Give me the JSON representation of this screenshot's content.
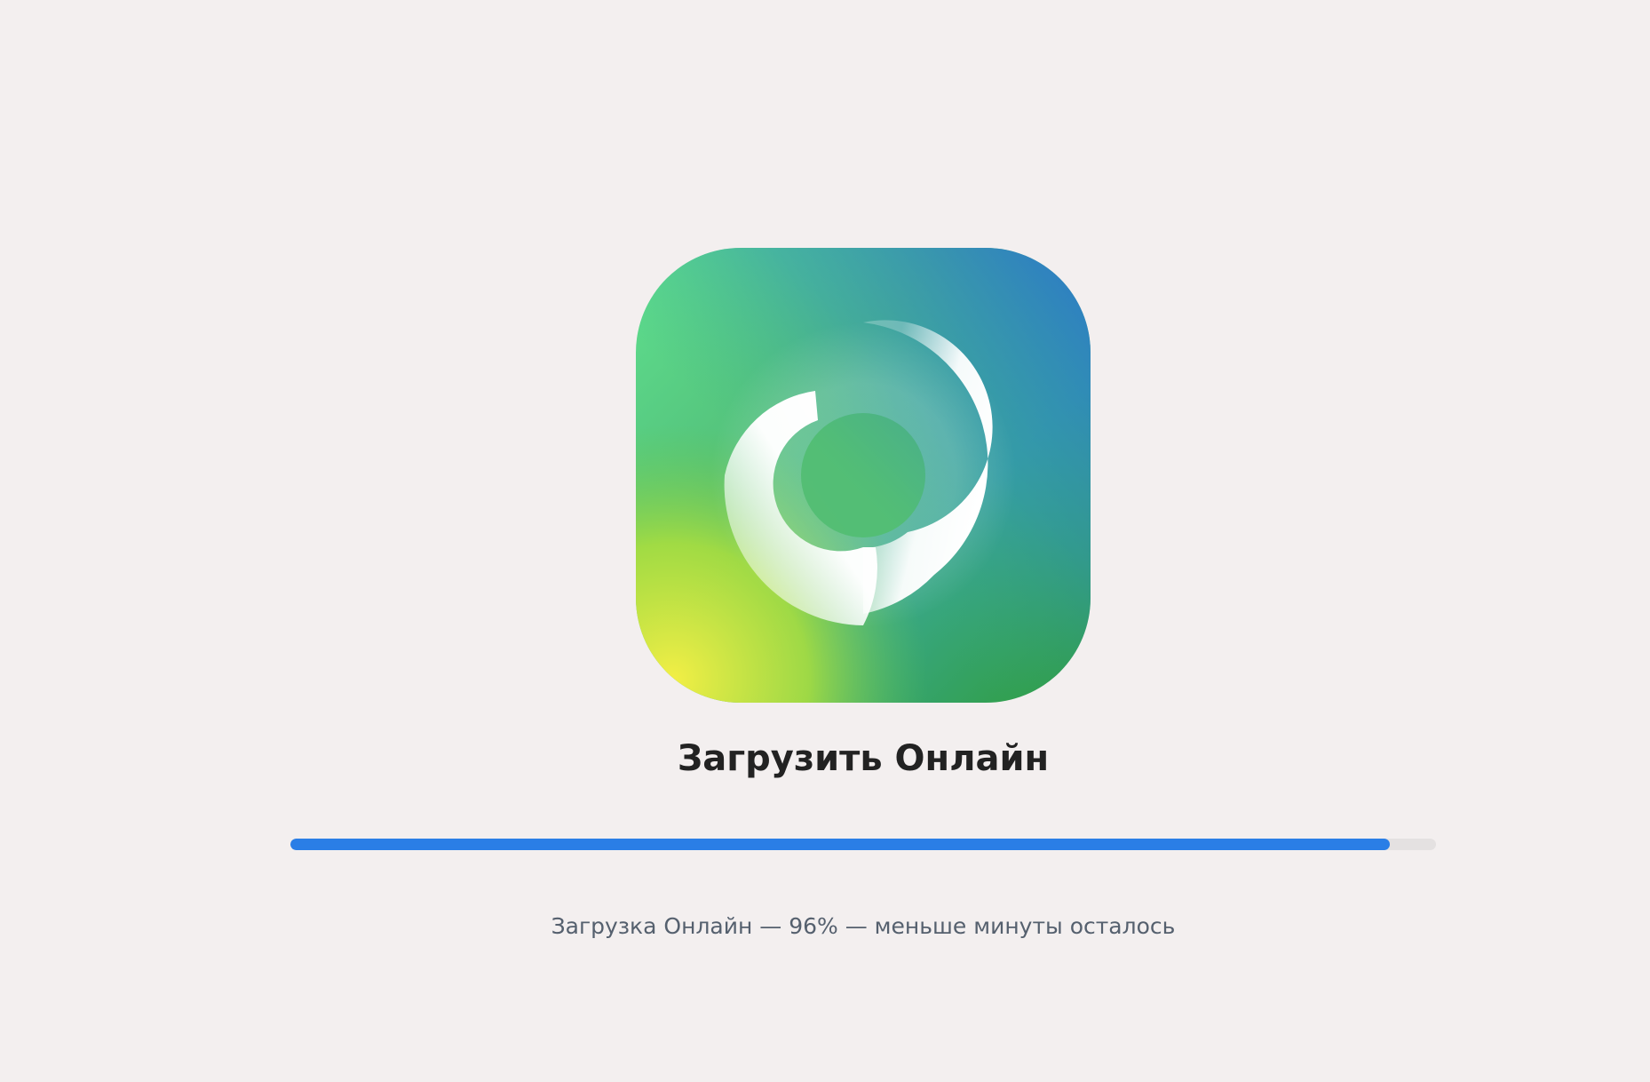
{
  "app": {
    "icon": "online-app-icon",
    "title": "Загрузить Онлайн"
  },
  "download": {
    "progress_percent": 96,
    "status_text": "Загрузка Онлайн — 96% — меньше минуты осталось"
  },
  "colors": {
    "background": "#f3efef",
    "progress_fill": "#2a7ee6",
    "progress_track": "#e4e1e1",
    "title_text": "#222222",
    "status_text": "#55606e"
  }
}
